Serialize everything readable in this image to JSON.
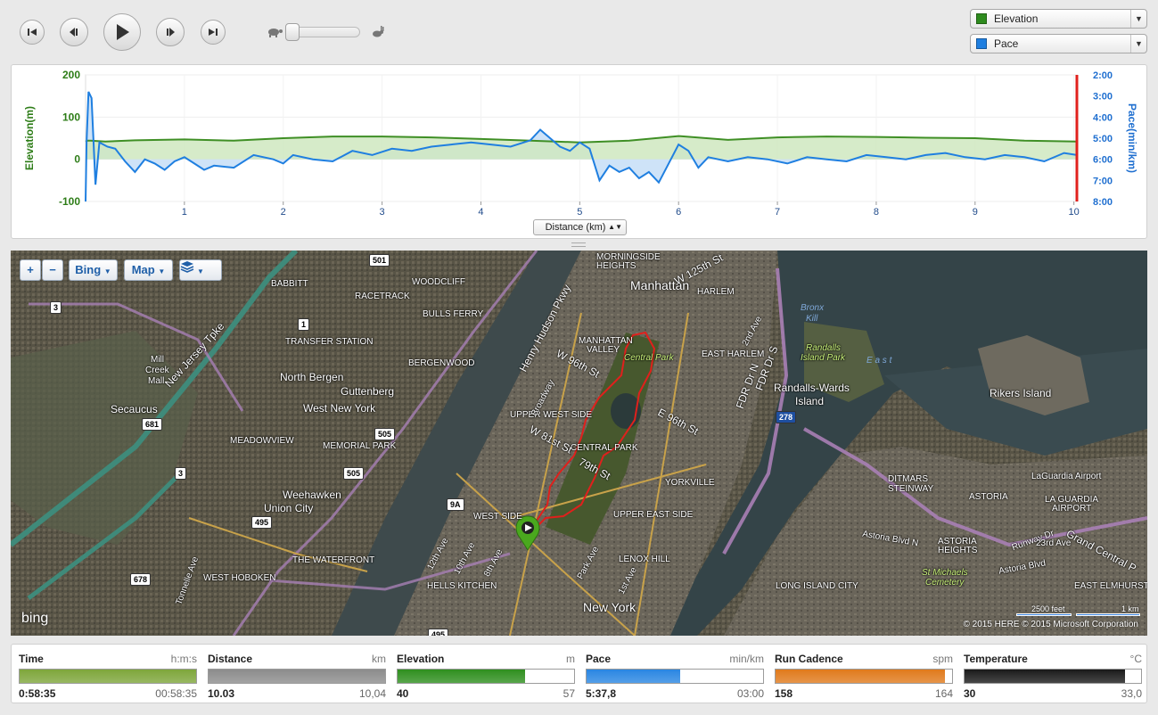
{
  "player": {
    "buttons": [
      {
        "name": "skip-to-start",
        "icon": "skip-start-icon"
      },
      {
        "name": "step-back",
        "icon": "step-back-icon"
      },
      {
        "name": "play",
        "icon": "play-icon"
      },
      {
        "name": "step-forward",
        "icon": "step-forward-icon"
      },
      {
        "name": "skip-to-end",
        "icon": "skip-end-icon"
      }
    ],
    "speed_slider": {
      "slow_icon": "turtle-icon",
      "fast_icon": "rabbit-icon",
      "level": 0.0
    }
  },
  "series_selectors": [
    {
      "label": "Elevation",
      "color": "#2e8b1e"
    },
    {
      "label": "Pace",
      "color": "#1f7fe0"
    }
  ],
  "chart_data": {
    "type": "area",
    "xlabel": "Distance (km)",
    "x_ticks": [
      "1",
      "2",
      "3",
      "4",
      "5",
      "6",
      "7",
      "8",
      "9",
      "10"
    ],
    "xlim": [
      0,
      10.03
    ],
    "left_axis": {
      "label": "Elevation(m)",
      "ticks": [
        "200",
        "100",
        "0",
        "-100"
      ],
      "ylim": [
        -100,
        200
      ],
      "color": "#2e7d18"
    },
    "right_axis": {
      "label": "Pace(min/km)",
      "ticks": [
        "2:00",
        "3:00",
        "4:00",
        "5:00",
        "6:00",
        "7:00",
        "8:00"
      ],
      "ylim_minutes": [
        2,
        8
      ],
      "inverted": true,
      "color": "#1f6fd0"
    },
    "series": [
      {
        "name": "Elevation",
        "axis": "left",
        "color": "#3f8f25",
        "x": [
          0,
          0.02,
          0.05,
          0.2,
          0.5,
          1.0,
          1.5,
          2.0,
          2.5,
          3.0,
          3.5,
          4.0,
          4.5,
          5.0,
          5.5,
          6.0,
          6.5,
          7.0,
          7.5,
          8.0,
          8.5,
          9.0,
          9.5,
          10.03
        ],
        "y": [
          42,
          44,
          44,
          42,
          45,
          47,
          44,
          50,
          54,
          54,
          52,
          48,
          44,
          40,
          44,
          55,
          46,
          52,
          54,
          53,
          51,
          50,
          44,
          42
        ]
      },
      {
        "name": "Pace",
        "axis": "right",
        "color": "#1f7fe0",
        "x": [
          0,
          0.01,
          0.03,
          0.06,
          0.1,
          0.14,
          0.18,
          0.22,
          0.3,
          0.4,
          0.5,
          0.6,
          0.7,
          0.8,
          0.9,
          1.0,
          1.1,
          1.2,
          1.3,
          1.5,
          1.7,
          1.9,
          2.0,
          2.1,
          2.3,
          2.5,
          2.7,
          2.9,
          3.1,
          3.3,
          3.5,
          3.7,
          3.9,
          4.1,
          4.3,
          4.5,
          4.6,
          4.7,
          4.8,
          4.9,
          5.0,
          5.1,
          5.2,
          5.3,
          5.4,
          5.5,
          5.6,
          5.7,
          5.8,
          5.9,
          6.0,
          6.1,
          6.2,
          6.3,
          6.5,
          6.7,
          6.9,
          7.1,
          7.3,
          7.5,
          7.7,
          7.9,
          8.1,
          8.3,
          8.5,
          8.7,
          8.9,
          9.1,
          9.3,
          9.5,
          9.7,
          9.9,
          10.03
        ],
        "y": [
          8.0,
          5.2,
          2.8,
          3.1,
          7.2,
          5.2,
          5.3,
          5.4,
          5.5,
          6.1,
          6.6,
          6.0,
          6.2,
          6.5,
          6.1,
          5.9,
          6.2,
          6.5,
          6.3,
          6.4,
          5.8,
          6.0,
          6.2,
          5.8,
          6.0,
          6.1,
          5.6,
          5.8,
          5.5,
          5.6,
          5.4,
          5.3,
          5.2,
          5.3,
          5.4,
          5.1,
          4.6,
          5.0,
          5.4,
          5.6,
          5.2,
          5.5,
          7.0,
          6.3,
          6.6,
          6.4,
          6.9,
          6.6,
          7.1,
          6.2,
          5.3,
          5.6,
          6.4,
          5.9,
          6.1,
          5.9,
          6.0,
          6.2,
          5.9,
          6.0,
          6.1,
          5.8,
          5.9,
          6.0,
          5.8,
          5.7,
          5.9,
          6.0,
          5.8,
          5.9,
          6.1,
          5.7,
          5.8
        ]
      }
    ],
    "cursor_x": 10.03,
    "grid": true
  },
  "distance_selector": {
    "label": "Distance (km)"
  },
  "map": {
    "controls": {
      "zoom_in": "+",
      "zoom_out": "−",
      "provider": "Bing",
      "type": "Map",
      "layers_icon": "layers-icon"
    },
    "labels": [
      {
        "text": "Manhattan",
        "cls": "city"
      },
      {
        "text": "New York",
        "cls": "city"
      },
      {
        "text": "North Bergen",
        "cls": "big"
      },
      {
        "text": "Guttenberg",
        "cls": "big"
      },
      {
        "text": "West New York",
        "cls": "big"
      },
      {
        "text": "Weehawken",
        "cls": "big"
      },
      {
        "text": "Union City",
        "cls": "big"
      },
      {
        "text": "Secaucus",
        "cls": "big"
      },
      {
        "text": "Randalls-Wards",
        "cls": "big"
      },
      {
        "text": "Island",
        "cls": "big"
      },
      {
        "text": "Rikers Island",
        "cls": "big"
      },
      {
        "text": "LaGuardia Airport",
        "cls": ""
      },
      {
        "text": "LA GUARDIA",
        "cls": ""
      },
      {
        "text": "AIRPORT",
        "cls": ""
      },
      {
        "text": "ASTORIA",
        "cls": ""
      },
      {
        "text": "DITMARS",
        "cls": ""
      },
      {
        "text": "STEINWAY",
        "cls": ""
      },
      {
        "text": "ASTORIA",
        "cls": ""
      },
      {
        "text": "HEIGHTS",
        "cls": ""
      },
      {
        "text": "EAST ELMHURST",
        "cls": ""
      },
      {
        "text": "LONG ISLAND CITY",
        "cls": ""
      },
      {
        "text": "St Michaels",
        "cls": "park"
      },
      {
        "text": "Cemetery",
        "cls": "park"
      },
      {
        "text": "Central Park",
        "cls": "park"
      },
      {
        "text": "Randalls",
        "cls": "park"
      },
      {
        "text": "Island Park",
        "cls": "park"
      },
      {
        "text": "Bronx",
        "cls": "water"
      },
      {
        "text": "Kill",
        "cls": "water"
      },
      {
        "text": "E  a  s  t",
        "cls": "water"
      },
      {
        "text": "HARLEM",
        "cls": ""
      },
      {
        "text": "EAST HARLEM",
        "cls": ""
      },
      {
        "text": "MORNINGSIDE",
        "cls": ""
      },
      {
        "text": "HEIGHTS",
        "cls": ""
      },
      {
        "text": "MANHATTAN",
        "cls": ""
      },
      {
        "text": "VALLEY",
        "cls": ""
      },
      {
        "text": "UPPER WEST SIDE",
        "cls": ""
      },
      {
        "text": "CENTRAL PARK",
        "cls": ""
      },
      {
        "text": "YORKVILLE",
        "cls": ""
      },
      {
        "text": "UPPER EAST SIDE",
        "cls": ""
      },
      {
        "text": "LENOX HILL",
        "cls": ""
      },
      {
        "text": "WEST SIDE",
        "cls": ""
      },
      {
        "text": "HELLS KITCHEN",
        "cls": ""
      },
      {
        "text": "WEST HOBOKEN",
        "cls": ""
      },
      {
        "text": "THE WATERFRONT",
        "cls": ""
      },
      {
        "text": "MEADOWVIEW",
        "cls": ""
      },
      {
        "text": "MEMORIAL PARK",
        "cls": ""
      },
      {
        "text": "TRANSFER STATION",
        "cls": ""
      },
      {
        "text": "RACETRACK",
        "cls": ""
      },
      {
        "text": "WOODCLIFF",
        "cls": ""
      },
      {
        "text": "BULLS FERRY",
        "cls": ""
      },
      {
        "text": "BERGENWOOD",
        "cls": ""
      },
      {
        "text": "BABBITT",
        "cls": ""
      },
      {
        "text": "Mill",
        "cls": ""
      },
      {
        "text": "Creek",
        "cls": ""
      },
      {
        "text": "Mall",
        "cls": ""
      },
      {
        "text": "Henry Hudson Pkwy",
        "cls": "big"
      },
      {
        "text": "New Jersey Tpke",
        "cls": "big"
      },
      {
        "text": "W 125th St",
        "cls": "big"
      },
      {
        "text": "W 96th St",
        "cls": "big"
      },
      {
        "text": "W 81st St",
        "cls": "big"
      },
      {
        "text": "E 96th St",
        "cls": "big"
      },
      {
        "text": "79th St",
        "cls": "big"
      },
      {
        "text": "FDR Dr N",
        "cls": "big"
      },
      {
        "text": "FDR Dr S",
        "cls": "big"
      },
      {
        "text": "Grand Central P",
        "cls": "big"
      },
      {
        "text": "Astoria Blvd N",
        "cls": ""
      },
      {
        "text": "Astoria Blvd",
        "cls": ""
      },
      {
        "text": "12th Ave",
        "cls": ""
      },
      {
        "text": "8th Ave",
        "cls": ""
      },
      {
        "text": "10th Ave",
        "cls": ""
      },
      {
        "text": "1st Ave",
        "cls": ""
      },
      {
        "text": "Park Ave",
        "cls": ""
      },
      {
        "text": "2nd Ave",
        "cls": ""
      },
      {
        "text": "Tonnelle Ave",
        "cls": ""
      },
      {
        "text": "Broadway",
        "cls": ""
      },
      {
        "text": "Runway Dr",
        "cls": ""
      },
      {
        "text": "23rd Ave",
        "cls": ""
      }
    ],
    "shields": [
      "501",
      "1",
      "681",
      "3",
      "3",
      "505",
      "505",
      "495",
      "678",
      "9A",
      "495",
      "278"
    ],
    "provider_logo": "bing",
    "copyright": "© 2015 HERE  © 2015 Microsoft Corporation",
    "scale_feet": "2500 feet",
    "scale_km": "1 km"
  },
  "stats": [
    {
      "label": "Time",
      "unit": "h:m:s",
      "value": "0:58:35",
      "max": "00:58:35",
      "fill_fraction": 1.0,
      "color": "#7ea63b"
    },
    {
      "label": "Distance",
      "unit": "km",
      "value": "10.03",
      "max": "10,04",
      "fill_fraction": 1.0,
      "color": "#8c8c8c"
    },
    {
      "label": "Elevation",
      "unit": "m",
      "value": "40",
      "max": "57",
      "fill_fraction": 0.72,
      "color": "#2f8f1f"
    },
    {
      "label": "Pace",
      "unit": "min/km",
      "value": "5:37,8",
      "max": "03:00",
      "fill_fraction": 0.53,
      "color": "#2a86e2"
    },
    {
      "label": "Run Cadence",
      "unit": "spm",
      "value": "158",
      "max": "164",
      "fill_fraction": 0.96,
      "color": "#e07a1c"
    },
    {
      "label": "Temperature",
      "unit": "°C",
      "value": "30",
      "max": "33,0",
      "fill_fraction": 0.91,
      "color": "#1a1a1a"
    }
  ]
}
